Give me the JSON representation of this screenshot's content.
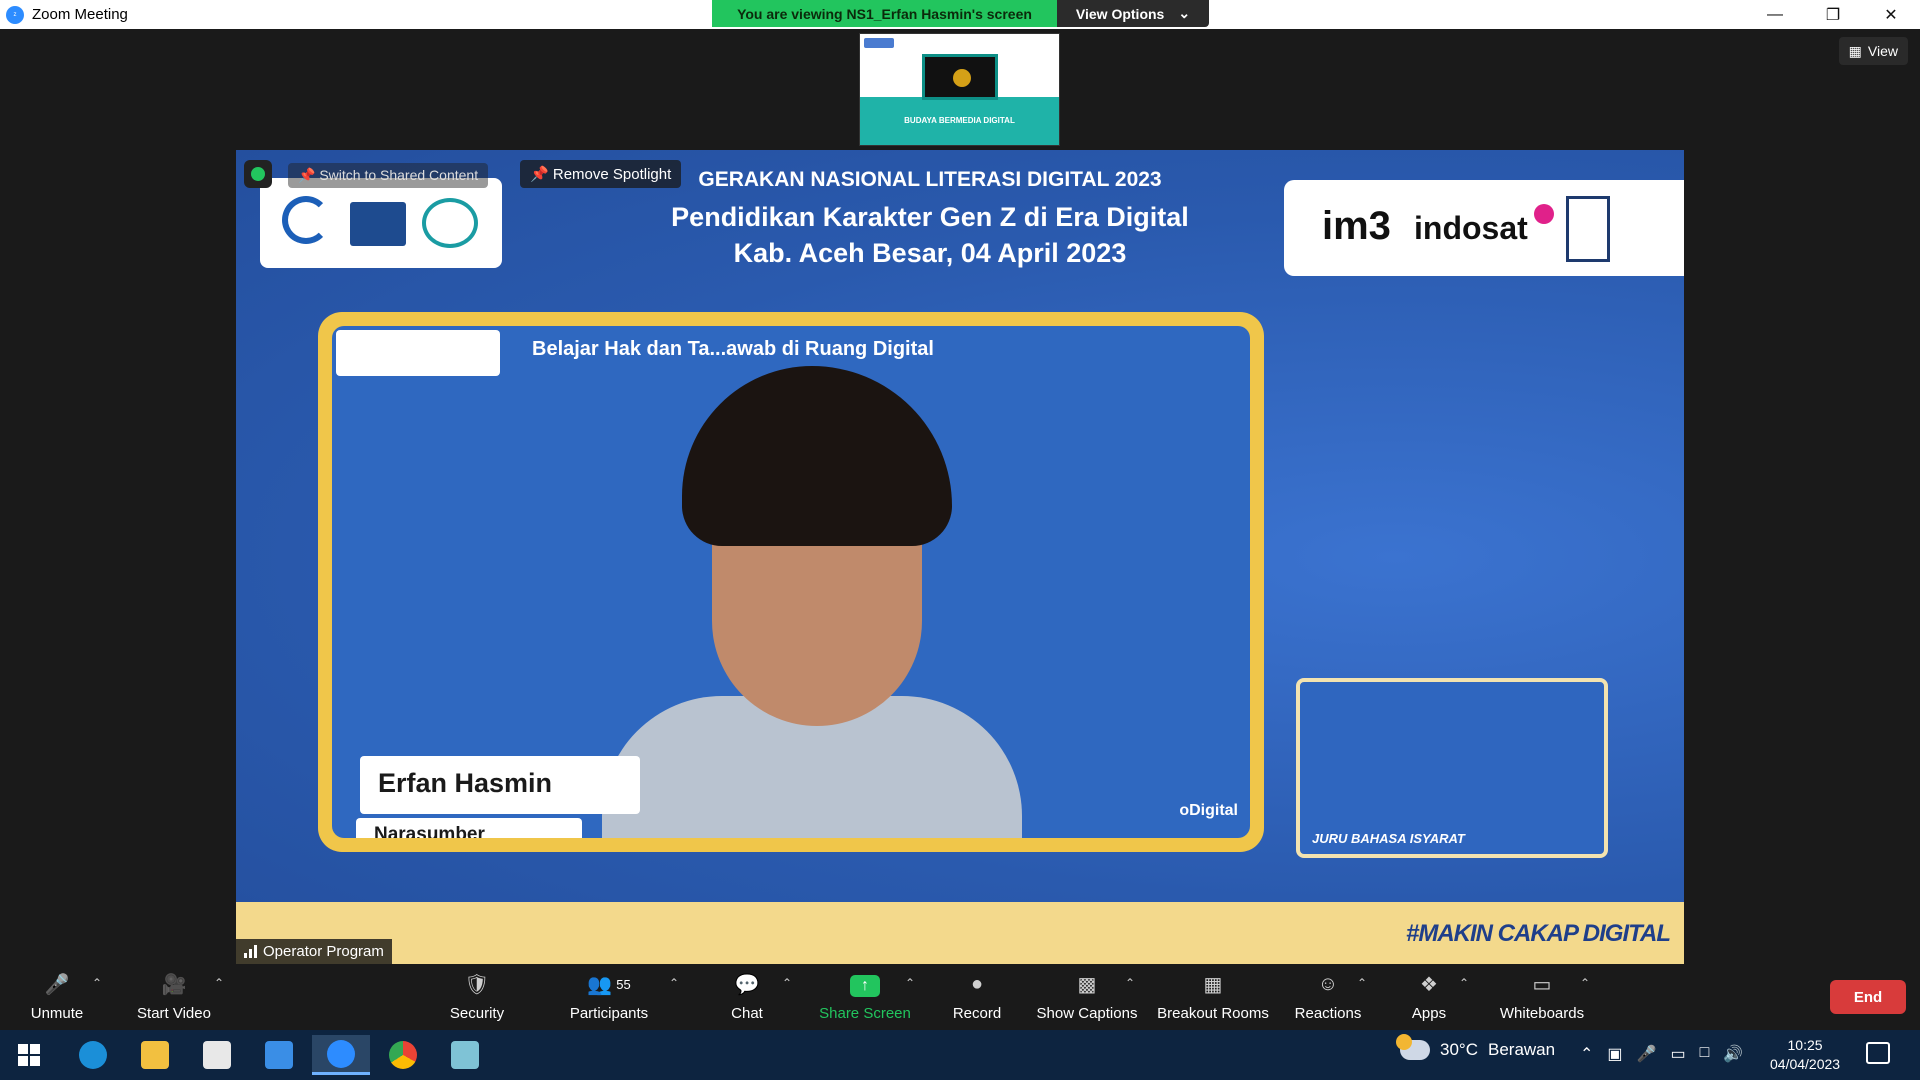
{
  "window": {
    "title": "Zoom Meeting"
  },
  "banner": {
    "viewing_text": "You are viewing NS1_Erfan Hasmin's screen",
    "view_options_label": "View Options"
  },
  "view_button": {
    "label": "View"
  },
  "thumbnail": {
    "title": "BUDAYA BERMEDIA DIGITAL"
  },
  "overlay": {
    "switch_label": "Switch to Shared Content",
    "remove_spotlight_label": "Remove Spotlight",
    "operator_label": "Operator Program"
  },
  "slide": {
    "line1": "GERAKAN NASIONAL LITERASI DIGITAL 2023",
    "line2": "Pendidikan Karakter Gen Z di Era Digital",
    "line3": "Kab. Aceh Besar, 04 April 2023",
    "inner_title": "Belajar Hak dan Ta...awab di Ruang Digital",
    "presenter_name": "Erfan Hasmin",
    "presenter_role": "Narasumber",
    "digital_tag": "oDigital",
    "jbi_label": "JURU BAHASA ISYARAT",
    "hashtag": "#MAKIN CAKAP DIGITAL",
    "sponsor_im3": "im3",
    "sponsor_indosat": "indosat"
  },
  "toolbar": {
    "unmute": "Unmute",
    "start_video": "Start Video",
    "security": "Security",
    "participants": "Participants",
    "participants_count": "55",
    "chat": "Chat",
    "share_screen": "Share Screen",
    "record": "Record",
    "show_captions": "Show Captions",
    "breakout_rooms": "Breakout Rooms",
    "reactions": "Reactions",
    "apps": "Apps",
    "whiteboards": "Whiteboards",
    "end": "End"
  },
  "taskbar": {
    "weather_temp": "30°C",
    "weather_desc": "Berawan",
    "time": "10:25",
    "date": "04/04/2023"
  },
  "colors": {
    "accent_green": "#22c55e",
    "end_red": "#d83b3b",
    "slide_blue": "#2d61b8",
    "frame_yellow": "#f0c64a"
  }
}
